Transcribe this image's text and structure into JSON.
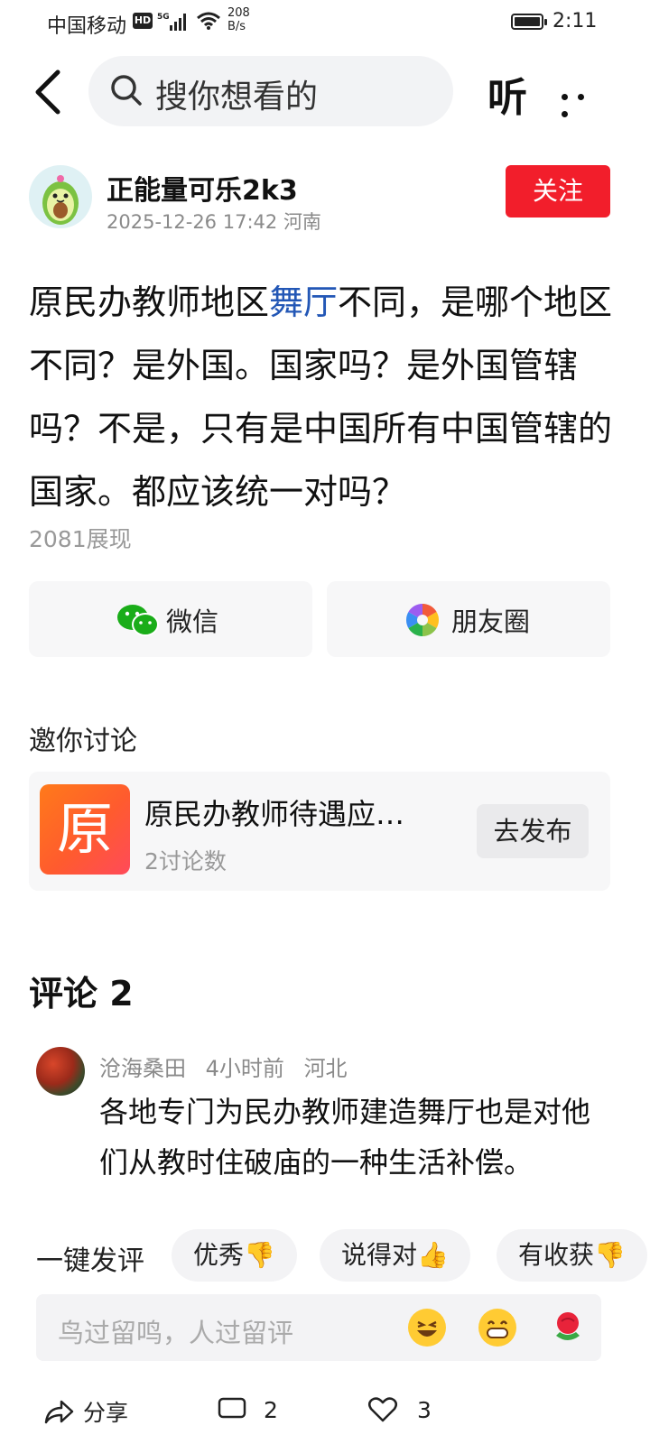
{
  "status_bar": {
    "carrier": "中国移动",
    "hd": "HD",
    "net_type": "5G",
    "speed_value": "208",
    "speed_unit": "B/s",
    "time": "2:11"
  },
  "top_bar": {
    "search_placeholder": "搜你想看的",
    "listen_label": "听"
  },
  "author": {
    "name": "正能量可乐2k3",
    "datetime": "2025-12-26 17:42",
    "location": "河南",
    "follow_label": "关注"
  },
  "post": {
    "text_before": "原民办教师地区",
    "link_text": "舞厅",
    "text_after": "不同，是哪个地区不同？是外国。国家吗？是外国管辖吗？不是，只有是中国所有中国管辖的国家。都应该统一对吗？",
    "views": "2081展现"
  },
  "share": {
    "wechat_label": "微信",
    "moments_label": "朋友圈"
  },
  "invite": {
    "title": "邀你讨论",
    "thumb_char": "原",
    "topic_name": "原民办教师待遇应…",
    "discussion_count": "2讨论数",
    "publish_label": "去发布"
  },
  "comments": {
    "title": "评论 2",
    "items": [
      {
        "user": "沧海桑田",
        "time": "4小时前",
        "location": "河北",
        "text": "各地专门为民办教师建造舞厅也是对他们从教时住破庙的一种生活补偿。"
      }
    ]
  },
  "quick_reply": {
    "label": "一键发评",
    "chips": [
      "优秀👎",
      "说得对👍",
      "有收获👎"
    ]
  },
  "input": {
    "placeholder": "鸟过留鸣，人过留评"
  },
  "bottom_bar": {
    "share_label": "分享",
    "comment_count": "2",
    "like_count": "3"
  },
  "colors": {
    "follow_button": "#f21e2b",
    "link_blue": "#2357b6",
    "wechat_green": "#1aad19"
  }
}
